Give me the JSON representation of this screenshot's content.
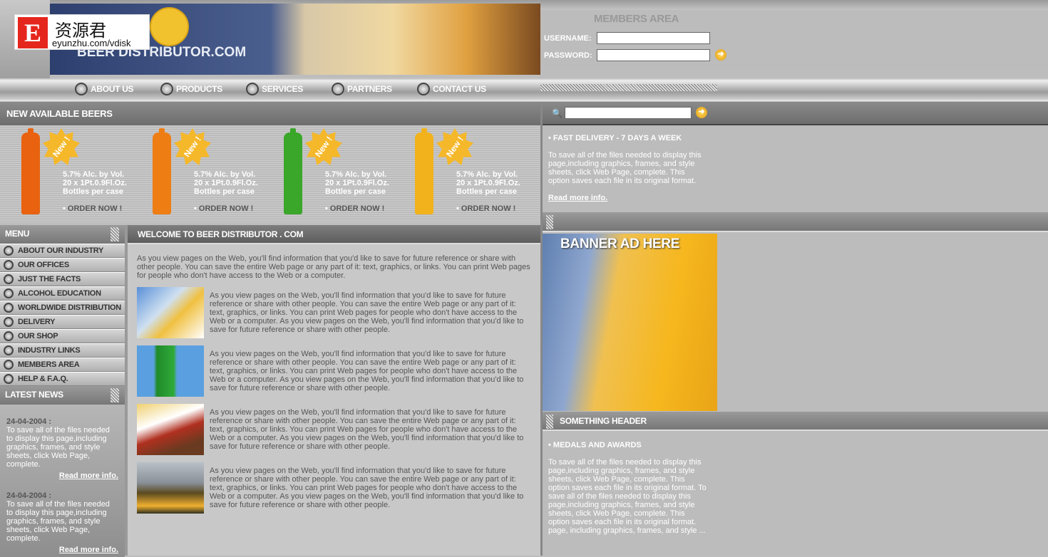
{
  "header": {
    "brand": "BEER DISTRIBUTOR.COM",
    "watermark": {
      "letter": "E",
      "cn": "资源君",
      "url": "eyunzhu.com/vdisk"
    }
  },
  "members": {
    "title": "MEMBERS AREA",
    "username_label": "USERNAME:",
    "password_label": "PASSWORD:",
    "username_value": "",
    "password_value": "",
    "go_icon": "arrow-right-icon"
  },
  "nav": [
    "ABOUT US",
    "PRODUCTS",
    "SERVICES",
    "PARTNERS",
    "CONTACT US"
  ],
  "beers": {
    "title": "NEW AVAILABLE BEERS",
    "badge": "New !",
    "items": [
      {
        "line1": "5.7% Alc. by Vol.",
        "line2": "20 x 1Pt.0.9Fl.Oz.",
        "line3": "Bottles per case",
        "order": "ORDER NOW !",
        "color": "#e8620f"
      },
      {
        "line1": "5.7% Alc. by Vol.",
        "line2": "20 x 1Pt.0.9Fl.Oz.",
        "line3": "Bottles per case",
        "order": "ORDER NOW !",
        "color": "#ee7d14"
      },
      {
        "line1": "5.7% Alc. by Vol.",
        "line2": "20 x 1Pt.0.9Fl.Oz.",
        "line3": "Bottles per case",
        "order": "ORDER NOW !",
        "color": "#3aa62a"
      },
      {
        "line1": "5.7% Alc. by Vol.",
        "line2": "20 x 1Pt.0.9Fl.Oz.",
        "line3": "Bottles per case",
        "order": "ORDER NOW !",
        "color": "#f1b21c"
      }
    ]
  },
  "menu": {
    "title": "MENU",
    "items": [
      "ABOUT OUR INDUSTRY",
      "OUR OFFICES",
      "JUST THE FACTS",
      "ALCOHOL EDUCATION",
      "WORLDWIDE DISTRIBUTION",
      "DELIVERY",
      "OUR SHOP",
      "INDUSTRY LINKS",
      "MEMBERS AREA",
      "HELP & F.A.Q."
    ]
  },
  "news": {
    "title": "LATEST NEWS",
    "items": [
      {
        "date": "24-04-2004 :",
        "text": "To save all of the files needed to display this page,including graphics, frames, and style sheets, click Web Page, complete.",
        "more": "Read more info."
      },
      {
        "date": "24-04-2004 :",
        "text": "To save all of the files needed to display this page,including graphics, frames, and style sheets, click Web Page, complete.",
        "more": "Read more info."
      }
    ]
  },
  "main": {
    "title": "WELCOME TO BEER DISTRIBUTOR . COM",
    "intro": "As you view pages on the Web, you'll find information that you'd like to save for future reference or share with other people. You can save the entire Web page or any part of it: text, graphics, or links. You can print Web pages for people who don't have access to the Web or a computer.",
    "rows": [
      {
        "text": "As you view pages on the Web, you'll find information that you'd like to save for future reference or share with other people. You can save the entire Web page or any part of it: text, graphics, or links. You can print Web pages for people who don't have access to the Web or a computer. As you view pages on the Web, you'll find information that you'd like to save for future reference or share with other people.",
        "img": "beer-toast"
      },
      {
        "text": "As you view pages on the Web, you'll find information that you'd like to save for future reference or share with other people. You can save the entire Web page or any part of it: text, graphics, or links. You can print Web pages for people who don't have access to the Web or a computer. As you view pages on the Web, you'll find information that you'd like to save for future reference or share with other people.",
        "img": "green-bottle"
      },
      {
        "text": "As you view pages on the Web, you'll find information that you'd like to save for future reference or share with other people. You can save the entire Web page or any part of it: text, graphics, or links. You can print Web pages for people who don't have access to the Web or a computer. As you view pages on the Web, you'll find information that you'd like to save for future reference or share with other people.",
        "img": "food"
      },
      {
        "text": "As you view pages on the Web, you'll find information that you'd like to save for future reference or share with other people. You can save the entire Web page or any part of it: text, graphics, or links. You can print Web pages for people who don't have access to the Web or a computer. As you view pages on the Web, you'll find information that you'd like to save for future reference or share with other people.",
        "img": "beer-mug"
      }
    ]
  },
  "right": {
    "search_value": "",
    "search_icon": "magnifier-icon",
    "delivery": {
      "title": "• FAST DELIVERY - 7 DAYS A WEEK",
      "text": "To save all of the files needed to display this page,including graphics, frames, and style sheets, click Web Page, complete. This option saves each file in its original format.",
      "more": "Read more info."
    },
    "banner": "BANNER AD HERE",
    "something_header": "SOMETHING HEADER",
    "medals": {
      "title": "• MEDALS AND AWARDS",
      "text": "To save all of the files needed to display this page,including graphics, frames, and style sheets, click Web Page, complete. This option saves each file in its original format. To save all of the files needed to display this page,including graphics, frames, and style sheets, click Web Page, complete. This option saves each file in its original format. page, including graphics, frames, and style ..."
    }
  }
}
